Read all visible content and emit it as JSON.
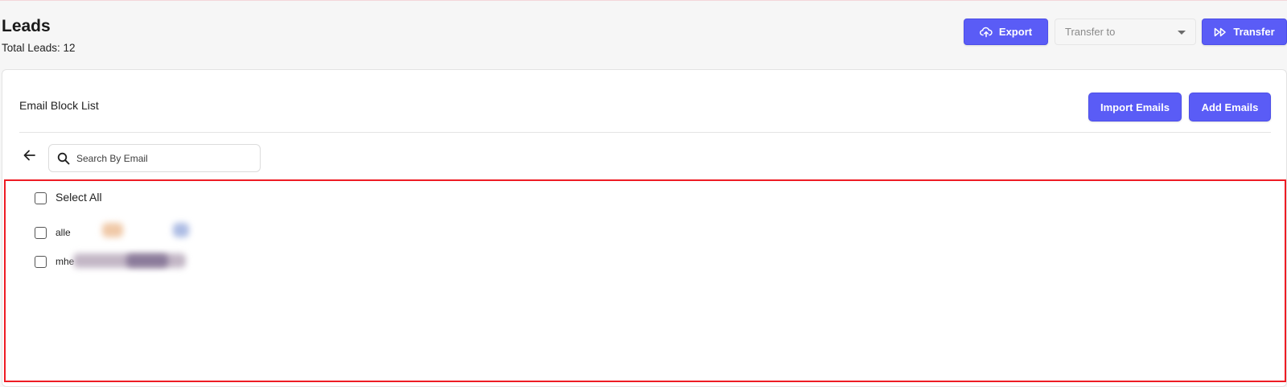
{
  "header": {
    "title": "Leads",
    "lead_count": "Total Leads: 12",
    "export_label": "Export",
    "transfer_select_value": "Transfer to",
    "transfer_label": "Transfer"
  },
  "email_block": {
    "title": "Email Block List",
    "import_label": "Import Emails",
    "add_label": "Add Emails",
    "search": {
      "placeholder": "Search By Email",
      "value": ""
    },
    "select_all_label": "Select All",
    "rows": [
      {
        "label": "alle"
      },
      {
        "label": "mhe"
      }
    ]
  },
  "colors": {
    "accent": "#5a5cf6",
    "highlight_border": "#ee1c24"
  },
  "icons": [
    "cloud-upload-icon",
    "chevron-down-icon",
    "fast-forward-icon",
    "arrow-left-icon",
    "search-icon"
  ]
}
